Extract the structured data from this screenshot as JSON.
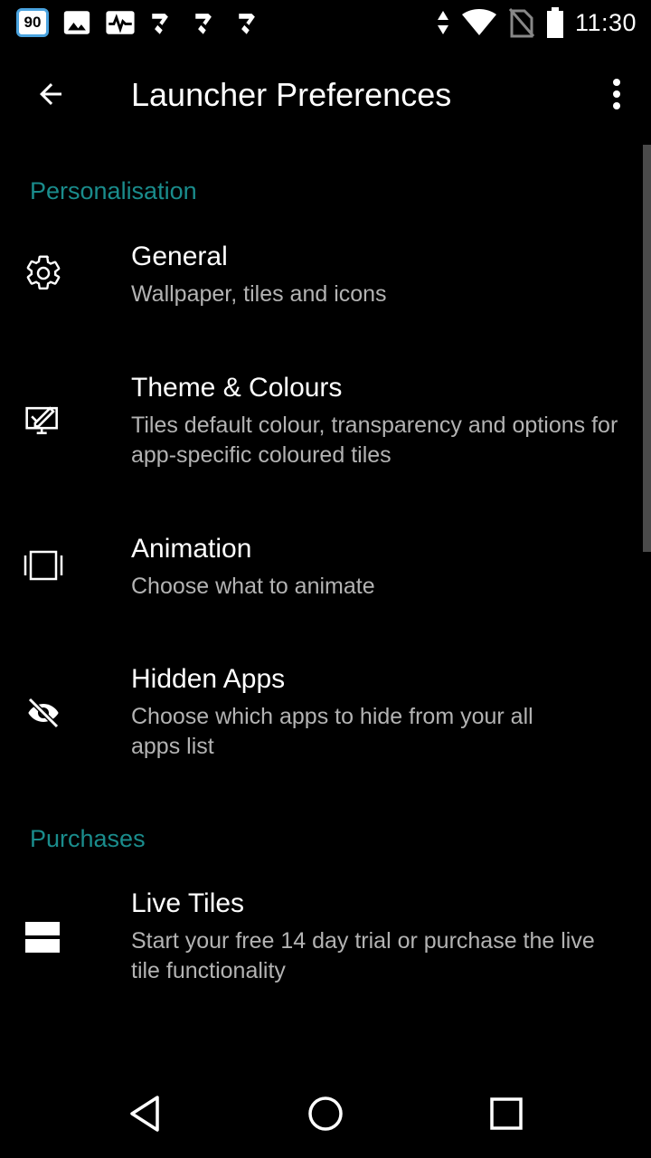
{
  "status_bar": {
    "badge": "90",
    "time": "11:30",
    "left_icons": [
      "notification-badge-icon",
      "image-icon",
      "activity-icon",
      "check-icon",
      "check-icon",
      "check-icon"
    ],
    "right_icons": [
      "data-arrows-icon",
      "wifi-icon",
      "no-sim-icon",
      "battery-icon"
    ]
  },
  "app_bar": {
    "title": "Launcher Preferences",
    "back_icon": "arrow-back-icon",
    "menu_icon": "more-vert-icon"
  },
  "sections": [
    {
      "header": "Personalisation",
      "items": [
        {
          "icon": "gear-icon",
          "title": "General",
          "summary": "Wallpaper, tiles and icons"
        },
        {
          "icon": "theme-palette-icon",
          "title": "Theme & Colours",
          "summary": "Tiles default colour, transparency and options for app-specific coloured tiles"
        },
        {
          "icon": "animation-icon",
          "title": "Animation",
          "summary": "Choose what to animate"
        },
        {
          "icon": "visibility-off-icon",
          "title": "Hidden Apps",
          "summary": "Choose which apps to hide from your all apps list"
        }
      ]
    },
    {
      "header": "Purchases",
      "items": [
        {
          "icon": "live-tiles-icon",
          "title": "Live Tiles",
          "summary": "Start your free 14 day trial or purchase the live tile functionality"
        }
      ]
    }
  ],
  "nav_bar": {
    "back_icon": "nav-back-icon",
    "home_icon": "nav-home-icon",
    "recents_icon": "nav-recents-icon"
  },
  "colors": {
    "background": "#000000",
    "accent": "#1a8c8c",
    "text_primary": "#ffffff",
    "text_secondary": "#b3b3b3"
  }
}
